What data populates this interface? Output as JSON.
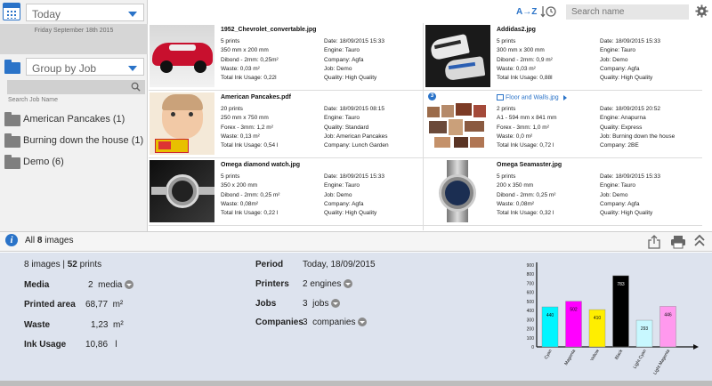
{
  "sidebar": {
    "date_filter": "Today",
    "date_text": "Friday September 18th 2015",
    "group_filter": "Group by Job",
    "search_label": "Search Job Name",
    "jobs": [
      {
        "label": "American Pancakes (1)"
      },
      {
        "label": "Burning down the house (1)"
      },
      {
        "label": "Demo (6)"
      }
    ]
  },
  "toolbar": {
    "sort_az": "A→Z",
    "search_placeholder": "Search name",
    "icons": [
      "calendar-icon",
      "folder-icon",
      "search-icon",
      "sort-time-icon",
      "gear-icon"
    ]
  },
  "cards": [
    {
      "name": "1952_Chevrolet_convertable.jpg",
      "col1": [
        "5 prints",
        "350 mm x 200 mm",
        "Dibond - 2mm: 0,25m²",
        "Waste: 0,03 m²",
        "Total Ink Usage: 0,22l"
      ],
      "col2": [
        "Date: 18/09/2015 15:33",
        "Engine: Tauro",
        "Company: Agfa",
        "Job: Demo",
        "Quality: High Quality"
      ],
      "thumb": "car"
    },
    {
      "name": "Addidas2.jpg",
      "col1": [
        "5 prints",
        "300 mm x 300 mm",
        "Dibond - 2mm: 0,9 m²",
        "Waste: 0,03 m²",
        "Total Ink Usage: 0,88l"
      ],
      "col2": [
        "Date: 18/09/2015 15:33",
        "Engine: Tauro",
        "Job: Demo",
        "Company: Agfa",
        "Quality: High Quality"
      ],
      "thumb": "shoes"
    },
    {
      "name": "American Pancakes.pdf",
      "col1": [
        "20 prints",
        "250 mm x 750 mm",
        "Forex - 3mm: 1,2 m²",
        "Waste: 0,13 m²",
        "Total Ink Usage: 0,54 l"
      ],
      "col2": [
        "Date: 18/09/2015 08:15",
        "Engine: Tauro",
        "Quality: Standard",
        "Job: American Pancakes",
        "Company: Lunch Garden"
      ],
      "thumb": "pancakes"
    },
    {
      "name": "Floor and Walls.jpg",
      "badge": "3",
      "col1": [
        "2 prints",
        "A1 - 594 mm x 841 mm",
        "Forex - 3mm: 1,0 m²",
        "Waste: 0,0 m²",
        "Total Ink Usage: 0,72 l"
      ],
      "col2": [
        "Date: 18/09/2015 20:52",
        "Engine: Anapurna",
        "Quality: Express",
        "Job: Burning down the house",
        "Company: 2BE"
      ],
      "thumb": "floor"
    },
    {
      "name": "Omega diamond watch.jpg",
      "col1": [
        "5 prints",
        "350 x 200 mm",
        "Dibond - 2mm: 0,25 m²",
        "Waste: 0,08m²",
        "Total Ink Usage: 0,22 l"
      ],
      "col2": [
        "Date: 18/09/2015 15:33",
        "Engine: Tauro",
        "Job: Demo",
        "Company: Agfa",
        "Quality: High Quality"
      ],
      "thumb": "watch1"
    },
    {
      "name": "Omega Seamaster.jpg",
      "col1": [
        "5 prints",
        "200 x 350 mm",
        "Dibond - 2mm: 0,25 m²",
        "Waste: 0,08m²",
        "Total Ink Usage: 0,32 l"
      ],
      "col2": [
        "Date: 18/09/2015 15:33",
        "Engine: Tauro",
        "Job: Demo",
        "Company: Agfa",
        "Quality: High Quality"
      ],
      "thumb": "watch2"
    }
  ],
  "summary": {
    "prefix": "All",
    "count": "8",
    "suffix": "images",
    "icons": [
      "info-icon",
      "share-icon",
      "print-icon",
      "collapse-icon"
    ]
  },
  "details": {
    "images": "8",
    "images_label": "images",
    "prints": "52",
    "prints_label": "prints",
    "media_label": "Media",
    "media_value": "2",
    "media_unit": "media",
    "printed_area_label": "Printed area",
    "printed_area_value": "68,77",
    "printed_area_unit": "m²",
    "waste_label": "Waste",
    "waste_value": "1,23",
    "waste_unit": "m²",
    "ink_label": "Ink Usage",
    "ink_value": "10,86",
    "ink_unit": "l",
    "period_label": "Period",
    "period_value": "Today, 18/09/2015",
    "printers_label": "Printers",
    "printers_value": "2",
    "printers_unit": "engines",
    "jobs_label": "Jobs",
    "jobs_value": "3",
    "jobs_unit": "jobs",
    "companies_label": "Companies",
    "companies_value": "3",
    "companies_unit": "companies"
  },
  "chart_data": {
    "type": "bar",
    "categories": [
      "Cyan",
      "Magenta",
      "Yellow",
      "Black",
      "Light Cyan",
      "Light Magenta"
    ],
    "values": [
      440,
      502,
      410,
      783,
      293,
      446
    ],
    "colors": [
      "#00f5ff",
      "#ff00ff",
      "#ffee00",
      "#000000",
      "#c8f8ff",
      "#ff99ee"
    ],
    "ylim": [
      0,
      900
    ],
    "yticks": [
      "900",
      "800",
      "700",
      "600",
      "500",
      "400",
      "300",
      "200",
      "100",
      "0"
    ]
  }
}
